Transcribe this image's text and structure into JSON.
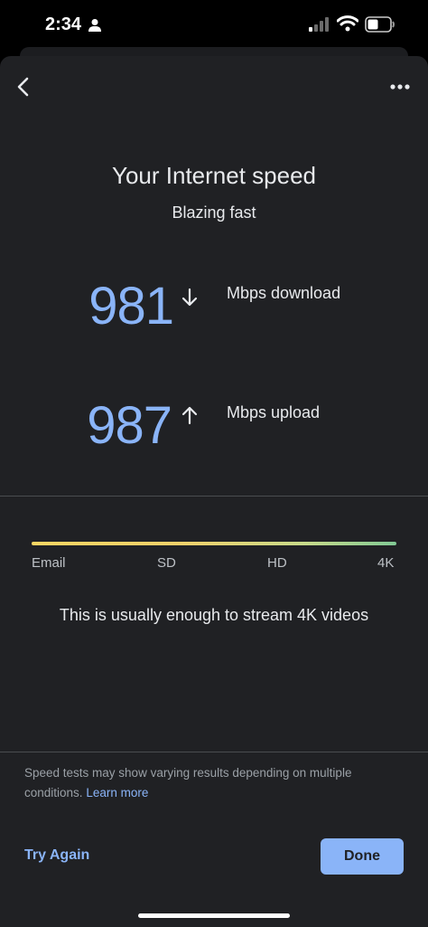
{
  "status_bar": {
    "time": "2:34"
  },
  "header": {
    "back_icon": "chevron-left-icon",
    "more_icon": "more-horizontal-icon"
  },
  "result": {
    "title": "Your Internet speed",
    "rating": "Blazing fast",
    "download": {
      "value": "981",
      "label": "Mbps download"
    },
    "upload": {
      "value": "987",
      "label": "Mbps upload"
    }
  },
  "quality_scale": {
    "ticks": [
      "Email",
      "SD",
      "HD",
      "4K"
    ],
    "description": "This is usually enough to stream 4K videos"
  },
  "footer": {
    "disclaimer": "Speed tests may show varying results depending on multiple conditions.",
    "learn_more": "Learn more",
    "try_again": "Try Again",
    "done": "Done"
  },
  "colors": {
    "accent": "#8ab4f8",
    "sheet_bg": "#202124"
  }
}
